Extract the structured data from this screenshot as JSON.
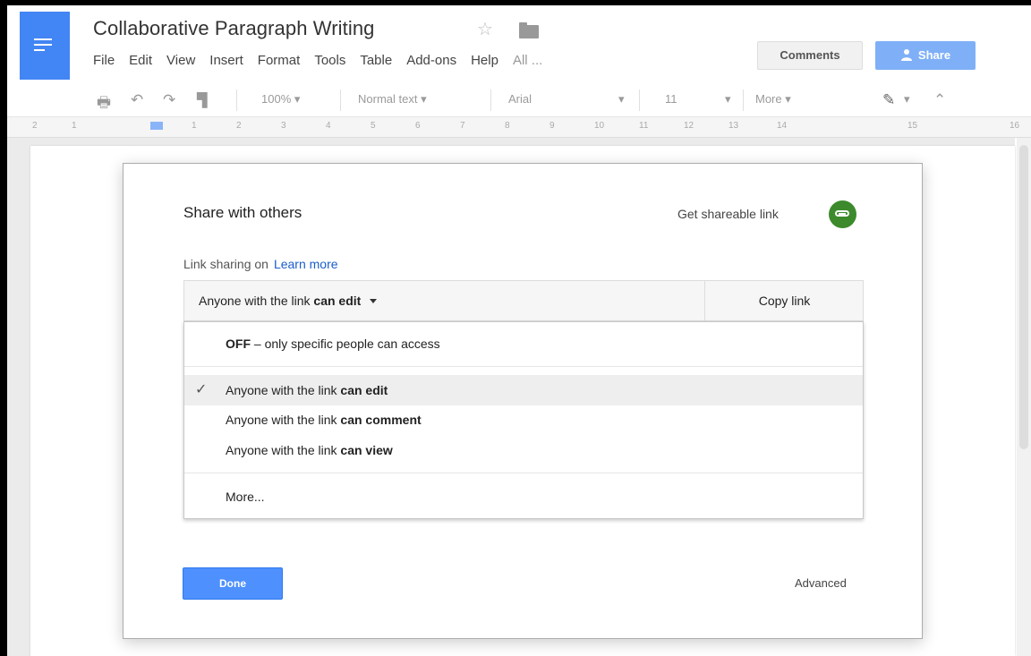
{
  "app": {
    "title": "Collaborative Paragraph Writing",
    "account": "",
    "menu": [
      "File",
      "Edit",
      "View",
      "Insert",
      "Format",
      "Tools",
      "Table",
      "Add-ons",
      "Help",
      "All ..."
    ],
    "comments_label": "Comments",
    "share_label": "Share"
  },
  "toolbar": {
    "zoom": "100%",
    "style": "Normal text",
    "font": "Arial",
    "size": "11",
    "more": "More"
  },
  "ruler": [
    "2",
    "1",
    "1",
    "2",
    "3",
    "4",
    "5",
    "6",
    "7",
    "8",
    "9",
    "10",
    "11",
    "12",
    "13",
    "14",
    "15",
    "16"
  ],
  "dialog": {
    "title": "Share with others",
    "get_link": "Get shareable link",
    "status": "Link sharing on",
    "learn_more": "Learn more",
    "selected_prefix": "Anyone with the link",
    "selected_bold": "can edit",
    "copy_link": "Copy link",
    "options": [
      {
        "bold": "OFF",
        "text": " – only specific people can access",
        "selected": false
      },
      {
        "text": "Anyone with the link ",
        "bold": "can edit",
        "selected": true
      },
      {
        "text": "Anyone with the link ",
        "bold": "can comment",
        "selected": false
      },
      {
        "text": "Anyone with the link ",
        "bold": "can view",
        "selected": false
      },
      {
        "text": "More...",
        "bold": "",
        "selected": false
      }
    ],
    "done": "Done",
    "advanced": "Advanced"
  },
  "colors": {
    "docs_blue": "#4285f4",
    "share_blue": "#7fb0f7",
    "done_blue": "#4d90fe",
    "link_green": "#3c8a2c",
    "link_text": "#1a5dcc"
  },
  "icons": [
    "docs-logo-icon",
    "star-icon",
    "folder-icon",
    "print-icon",
    "undo-icon",
    "redo-icon",
    "paint-format-icon",
    "pencil-icon",
    "collapse-icon",
    "link-icon",
    "check-icon"
  ]
}
